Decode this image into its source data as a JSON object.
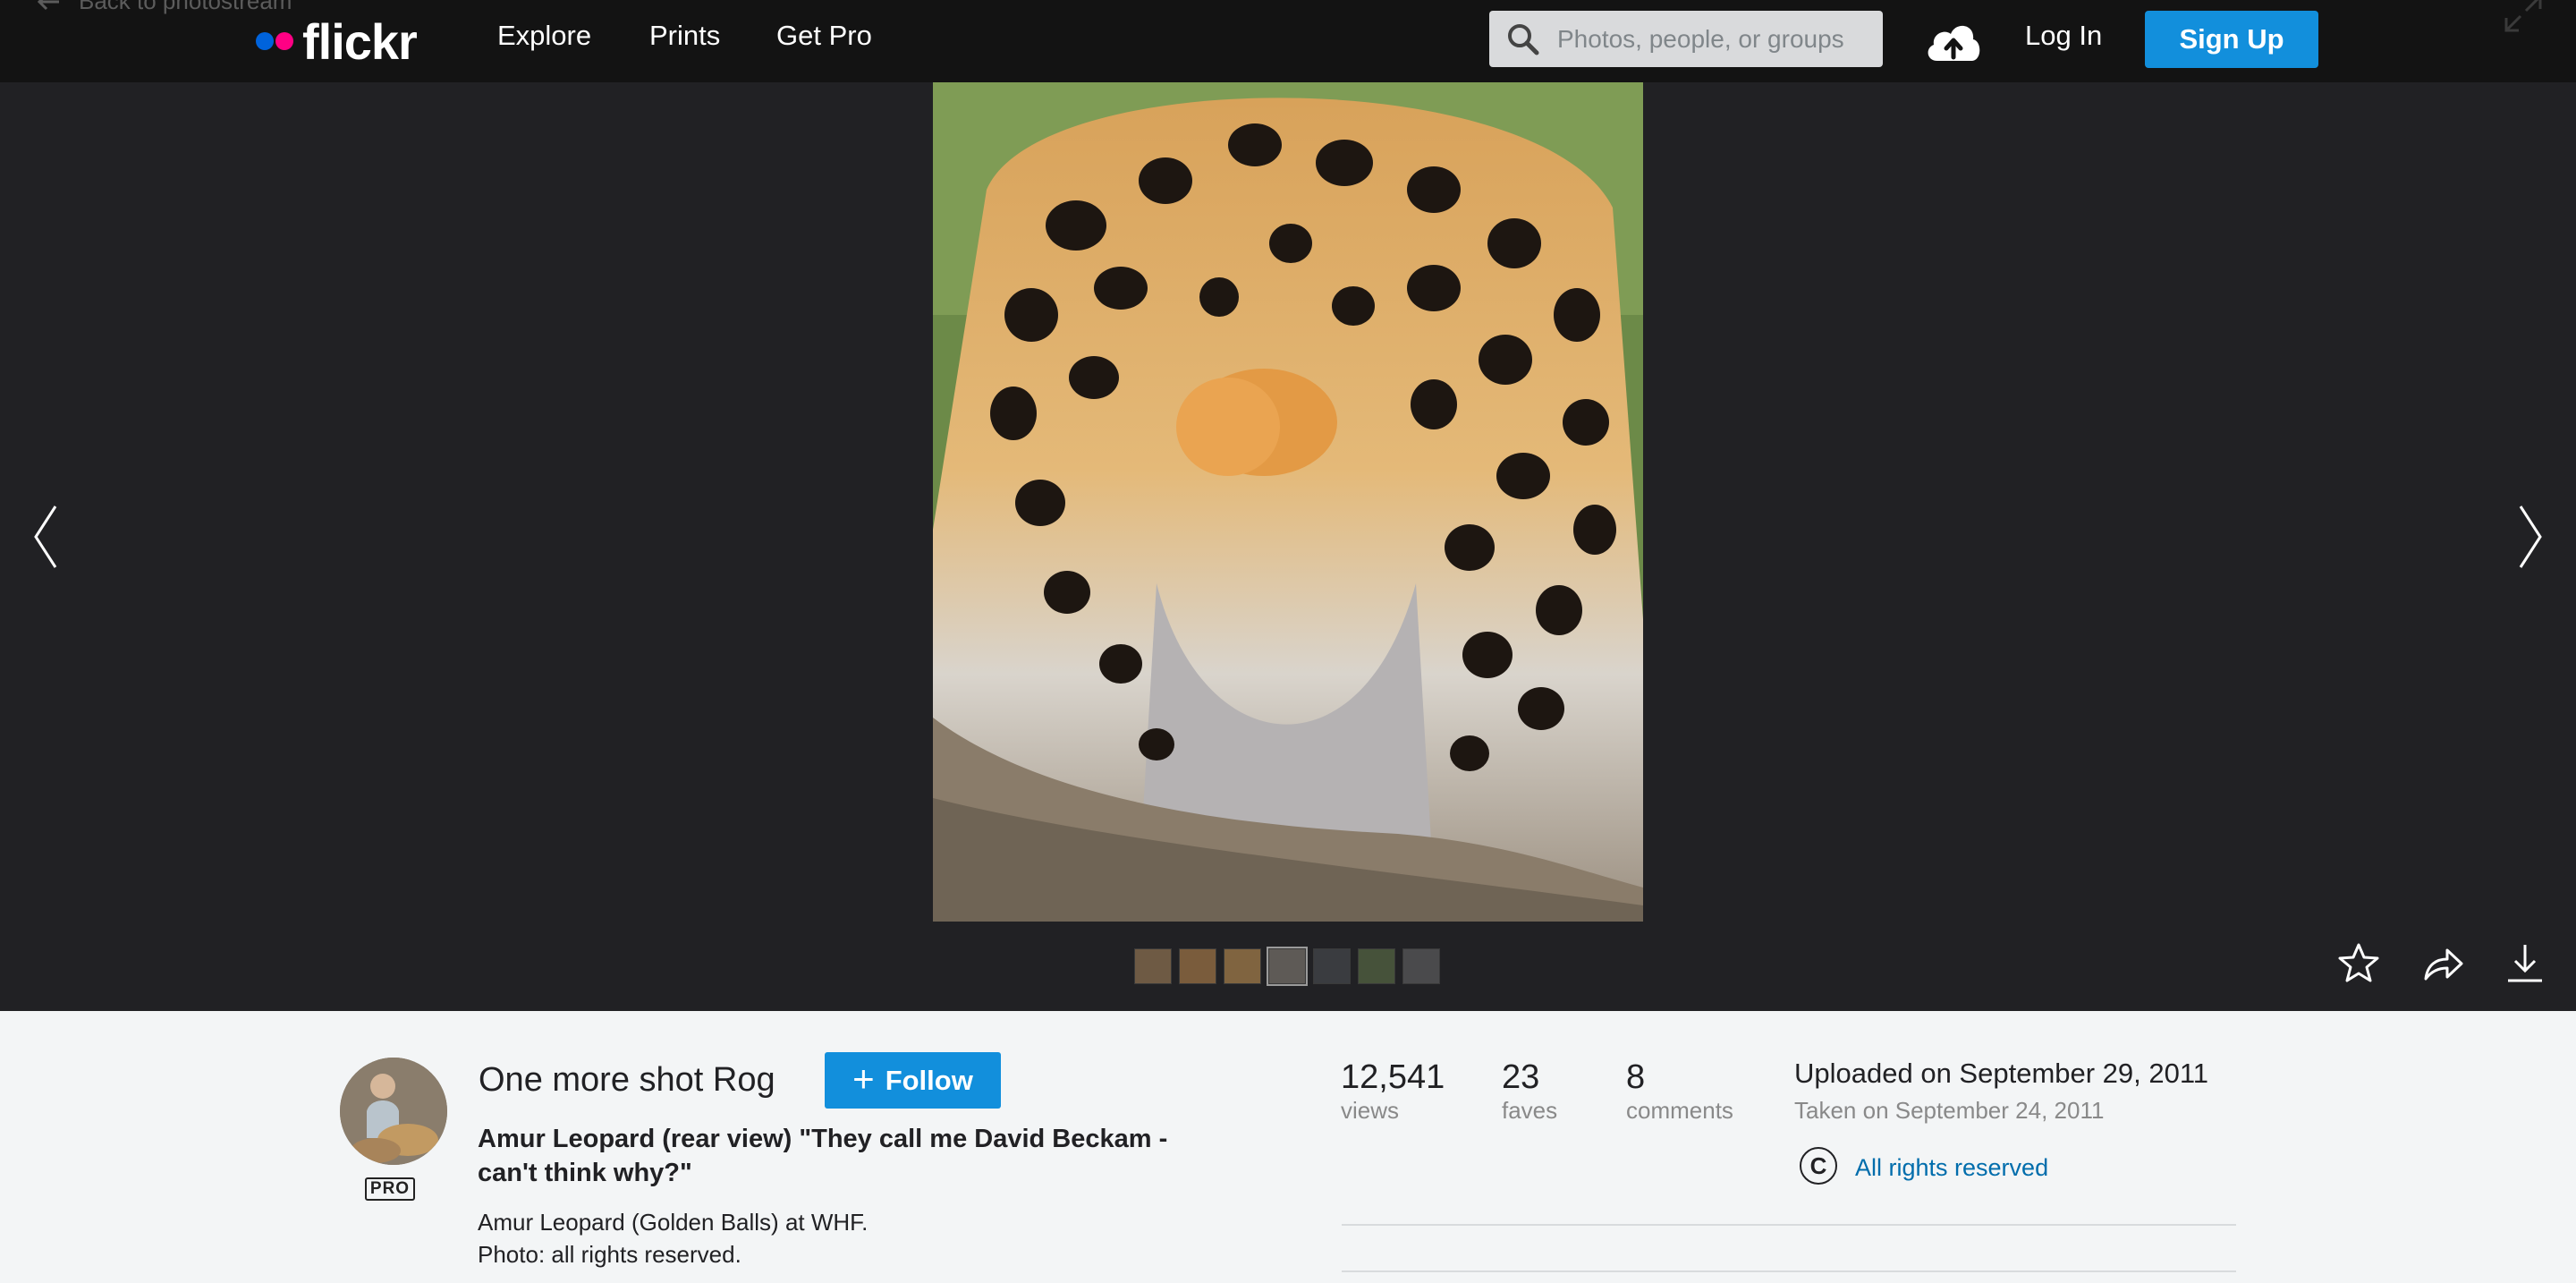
{
  "nav": {
    "back_label": "Back to photostream",
    "brand": "flickr",
    "items": [
      "Explore",
      "Prints",
      "Get Pro"
    ],
    "search_placeholder": "Photos, people, or groups",
    "login_label": "Log In",
    "signup_label": "Sign Up"
  },
  "colors": {
    "brand_blue": "#0063dc",
    "brand_pink": "#ff0084",
    "accent": "#128fdc",
    "link": "#006dac"
  },
  "photo": {
    "thumbnail_count": 7,
    "active_thumbnail": 4
  },
  "actions": [
    "star-icon",
    "share-icon",
    "download-icon"
  ],
  "owner": {
    "name": "One more shot Rog",
    "badge": "PRO",
    "follow_label": "Follow"
  },
  "details": {
    "title": "Amur Leopard (rear view) \"They call me David Beckam - can't think why?\"",
    "description_line1": "Amur Leopard (Golden Balls) at WHF.",
    "description_line2": "Photo: all rights reserved."
  },
  "stats": {
    "views": {
      "value": "12,541",
      "label": "views"
    },
    "faves": {
      "value": "23",
      "label": "faves"
    },
    "comments": {
      "value": "8",
      "label": "comments"
    }
  },
  "dates": {
    "uploaded": "Uploaded on September 29, 2011",
    "taken": "Taken on September 24, 2011"
  },
  "license": {
    "symbol": "C",
    "label": "All rights reserved"
  }
}
